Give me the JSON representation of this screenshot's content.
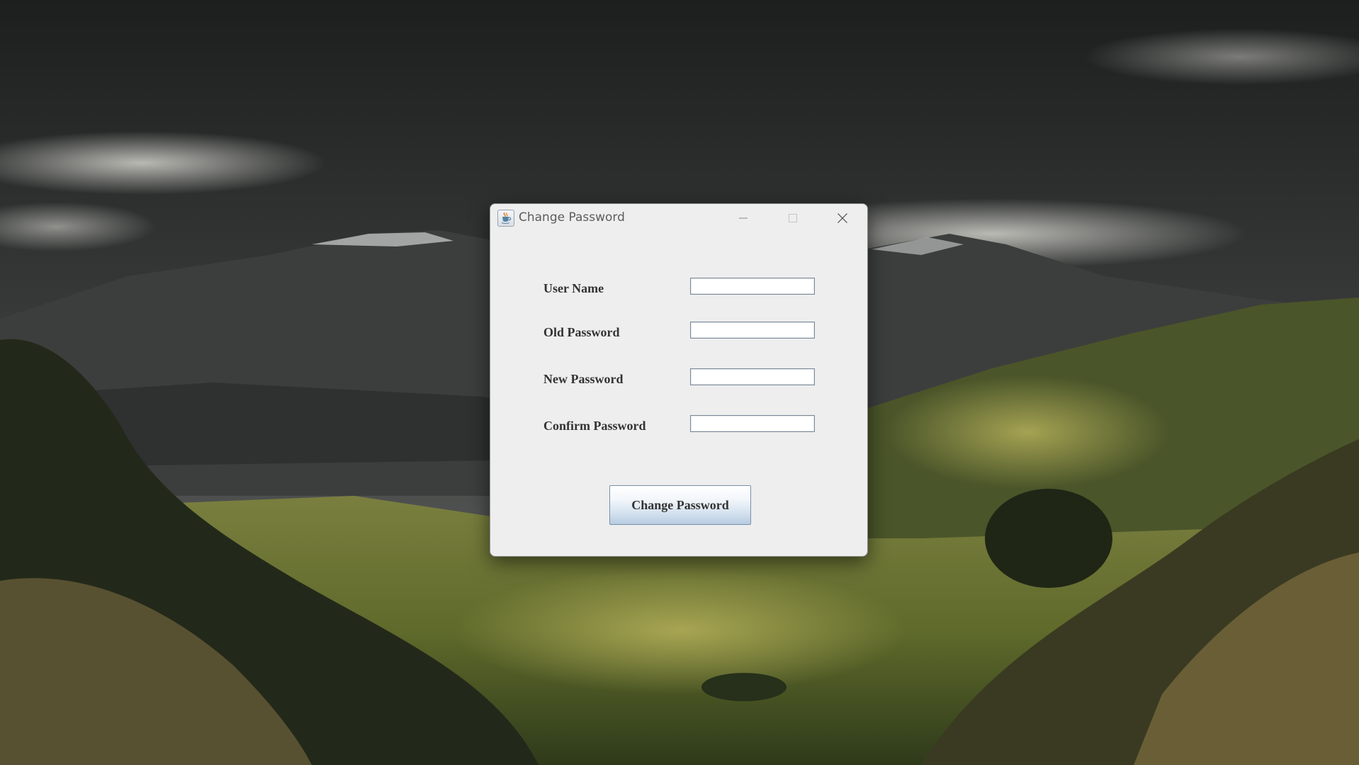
{
  "window": {
    "title": "Change Password",
    "app_icon": "java-coffee-cup-icon",
    "controls": {
      "minimize_icon": "minimize-icon",
      "maximize_icon": "maximize-icon",
      "close_icon": "close-icon"
    }
  },
  "form": {
    "fields": [
      {
        "label": "User Name",
        "value": ""
      },
      {
        "label": "Old Password",
        "value": ""
      },
      {
        "label": "New Password",
        "value": ""
      },
      {
        "label": "Confirm Password",
        "value": ""
      }
    ],
    "submit_label": "Change Password"
  },
  "colors": {
    "window_bg": "#eeeeee",
    "label_text": "#333333",
    "button_gradient_bottom": "#b7cce1"
  }
}
